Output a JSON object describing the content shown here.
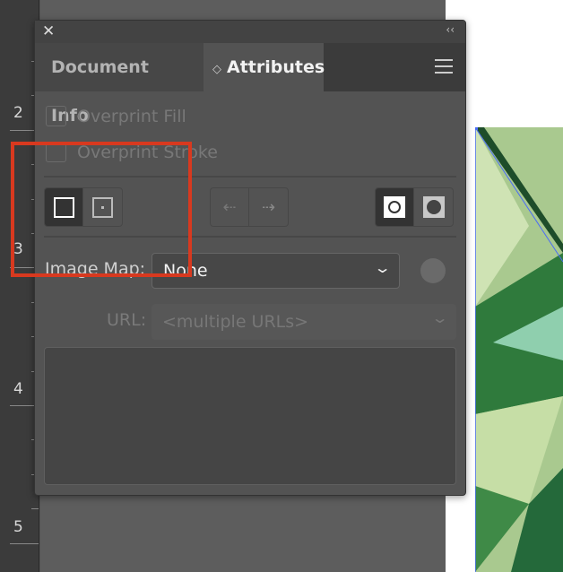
{
  "ruler": {
    "marks": [
      "2",
      "3",
      "4",
      "5"
    ]
  },
  "panel": {
    "close": "✕",
    "collapse": "‹‹",
    "tabs": [
      {
        "label": "Document Info",
        "active": false
      },
      {
        "label": "Attributes",
        "active": true
      }
    ],
    "tab_arrow": "◇",
    "overprint_fill": {
      "label": "Overprint Fill",
      "checked": false
    },
    "overprint_stroke": {
      "label": "Overprint Stroke",
      "checked": false
    },
    "image_map": {
      "label": "Image Map:",
      "value": "None"
    },
    "url": {
      "label": "URL:",
      "value": "<multiple URLs>"
    },
    "notes": ""
  },
  "colors": {
    "highlight": "#d8391f",
    "selection": "#4a6cf7"
  }
}
